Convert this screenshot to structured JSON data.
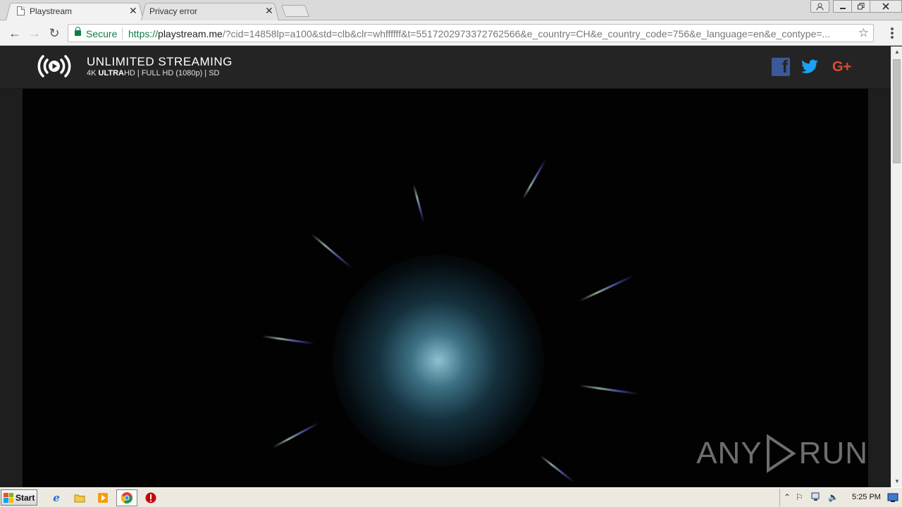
{
  "browser": {
    "tabs": [
      {
        "label": "Playstream",
        "active": true
      },
      {
        "label": "Privacy error",
        "active": false
      }
    ],
    "close_glyph": "✕",
    "nav": {
      "back": "←",
      "forward": "→",
      "reload": "↻"
    },
    "security_label": "Secure",
    "url": {
      "scheme": "https://",
      "host": "playstream.me",
      "rest": "/?cid=14858lp=a100&std=clb&clr=whffffff&t=5517202973372762566&e_country=CH&e_country_code=756&e_language=en&e_contype=..."
    },
    "bookmark_glyph": "☆"
  },
  "site": {
    "title": "UNLIMITED STREAMING",
    "subtitle_prefix": "4K ",
    "subtitle_bold": "ULTRA",
    "subtitle_rest": "HD | FULL HD (1080p) | SD",
    "social": {
      "facebook": "f",
      "googleplus": "G+"
    }
  },
  "player": {
    "watermark_left": "ANY",
    "watermark_right": "RUN"
  },
  "taskbar": {
    "start_label": "Start",
    "clock": "5:25 PM"
  },
  "colors": {
    "secure_green": "#0b8043",
    "facebook": "#3b5998",
    "twitter": "#1da1f2",
    "googleplus": "#dd4b39"
  }
}
